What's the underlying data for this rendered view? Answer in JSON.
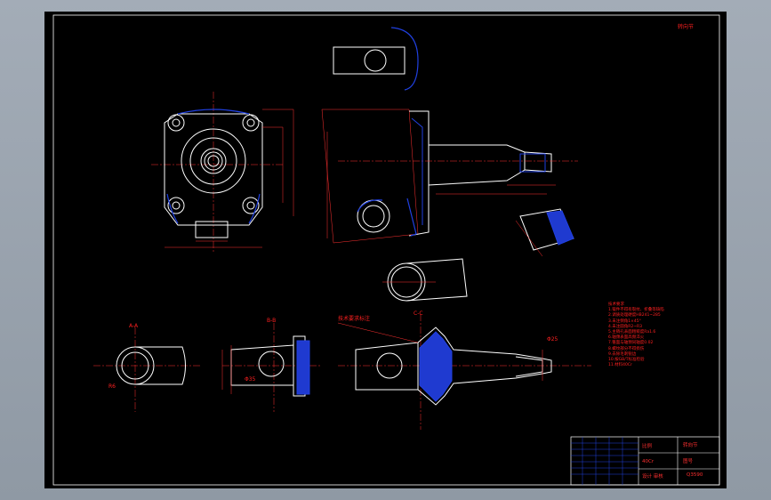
{
  "labels": {
    "corner_mark": "转向节",
    "section_a": "A-A",
    "section_b": "B-B",
    "section_c": "C-C",
    "dim_note_left": "R6",
    "dim_note_mid": "Φ35",
    "dim_note_right": "Φ25",
    "arrow_note": "技术要求标注"
  },
  "notes": {
    "title": "技术要求",
    "lines": [
      "1.锻件不得有裂纹、折叠等缺陷",
      "2.调质处理硬度HB241~285",
      "3.未注倒角1×45°",
      "4.未注圆角R2~R3",
      "5.主销孔表面粗糙度Ra1.6",
      "6.轴颈表面高频淬火",
      "7.锥面与轴颈同轴度0.02",
      "8.螺纹部分不得损伤",
      "9.去除毛刺锐边",
      "10.按GB/T标准检验",
      "11.材料40Cr"
    ]
  },
  "title_block": {
    "name": "转向节",
    "drawing_no": "图号",
    "material": "40Cr",
    "scale_label": "比例",
    "company": "设计 审核",
    "code": "Q3590"
  },
  "colors": {
    "outline": "#ffffff",
    "dimension": "#ff2020",
    "hatch": "#1f3ad0",
    "frame": "#ffffff"
  }
}
